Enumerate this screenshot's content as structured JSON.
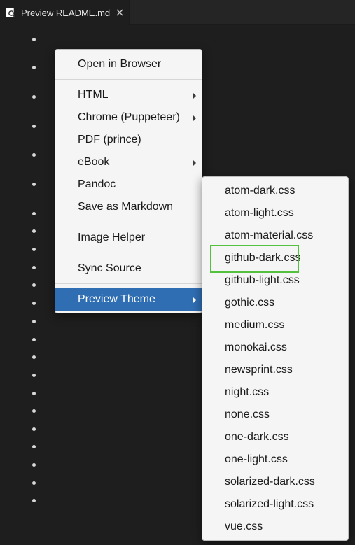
{
  "tab": {
    "title": "Preview README.md",
    "icon": "preview-icon",
    "close_icon": "close-icon"
  },
  "editor": {
    "bullet_count": 26
  },
  "main_menu": {
    "items": [
      {
        "label": "Open in Browser",
        "submenu": false
      },
      {
        "separator": true
      },
      {
        "label": "HTML",
        "submenu": true
      },
      {
        "label": "Chrome (Puppeteer)",
        "submenu": true
      },
      {
        "label": "PDF (prince)",
        "submenu": false
      },
      {
        "label": "eBook",
        "submenu": true
      },
      {
        "label": "Pandoc",
        "submenu": false
      },
      {
        "label": "Save as Markdown",
        "submenu": false
      },
      {
        "separator": true
      },
      {
        "label": "Image Helper",
        "submenu": false
      },
      {
        "separator": true
      },
      {
        "label": "Sync Source",
        "submenu": false
      },
      {
        "separator": true
      },
      {
        "label": "Preview Theme",
        "submenu": true,
        "selected": true
      }
    ]
  },
  "theme_menu": {
    "items": [
      "atom-dark.css",
      "atom-light.css",
      "atom-material.css",
      "github-dark.css",
      "github-light.css",
      "gothic.css",
      "medium.css",
      "monokai.css",
      "newsprint.css",
      "night.css",
      "none.css",
      "one-dark.css",
      "one-light.css",
      "solarized-dark.css",
      "solarized-light.css",
      "vue.css"
    ],
    "highlighted": "github-dark.css"
  },
  "colors": {
    "background": "#1e1e1e",
    "selection": "#2f6eb3",
    "highlight_border": "#53c13e"
  }
}
